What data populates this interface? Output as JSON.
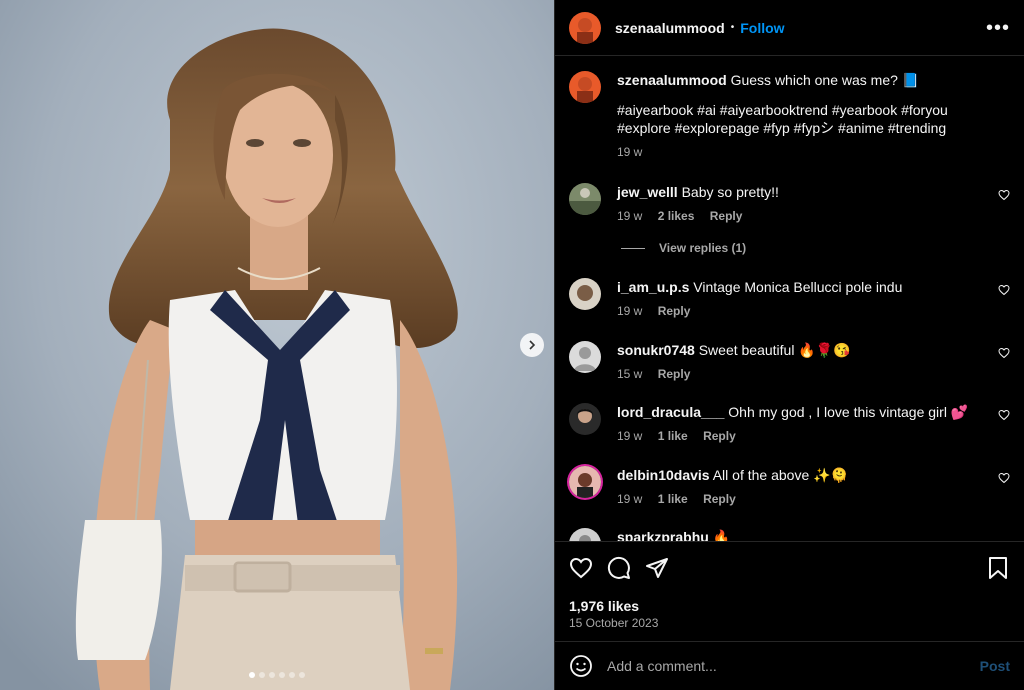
{
  "post": {
    "username": "szenaalummood",
    "follow_label": "Follow",
    "separator": "•",
    "more_label": "•••",
    "caption_text": "Guess which one was me? 📘",
    "hashtags": "#aiyearbook #ai #aiyearbooktrend #yearbook #foryou #explore #explorepage #fyp #fypシ #anime #trending",
    "caption_time": "19 w"
  },
  "comments": [
    {
      "user": "jew_welll",
      "text": "Baby so pretty!!",
      "time": "19 w",
      "likes": "2 likes",
      "reply": "Reply"
    },
    {
      "user": "i_am_u.p.s",
      "text": "Vintage Monica Bellucci pole indu",
      "time": "19 w",
      "likes": "",
      "reply": "Reply"
    },
    {
      "user": "sonukr0748",
      "text": "Sweet beautiful 🔥🌹😘",
      "time": "15 w",
      "likes": "",
      "reply": "Reply"
    },
    {
      "user": "lord_dracula___",
      "text": "Ohh my god , I love this vintage girl 💕",
      "time": "19 w",
      "likes": "1 like",
      "reply": "Reply"
    },
    {
      "user": "delbin10davis",
      "text": "All of the above ✨🫠",
      "time": "19 w",
      "likes": "1 like",
      "reply": "Reply"
    },
    {
      "user": "sparkzprabhu",
      "text": "🔥",
      "time": "",
      "likes": "",
      "reply": ""
    }
  ],
  "view_replies": "View replies (1)",
  "engagement": {
    "likes": "1,976 likes",
    "date": "15 October 2023"
  },
  "composer": {
    "placeholder": "Add a comment...",
    "post_label": "Post"
  },
  "carousel": {
    "count": 6,
    "active": 0
  },
  "colors": {
    "accent": "#0095f6",
    "background": "#000000",
    "muted": "#a8a8a8"
  },
  "icons": [
    "heart-icon",
    "comment-icon",
    "share-icon",
    "bookmark-icon",
    "emoji-icon",
    "chevron-right-icon",
    "more-icon"
  ]
}
